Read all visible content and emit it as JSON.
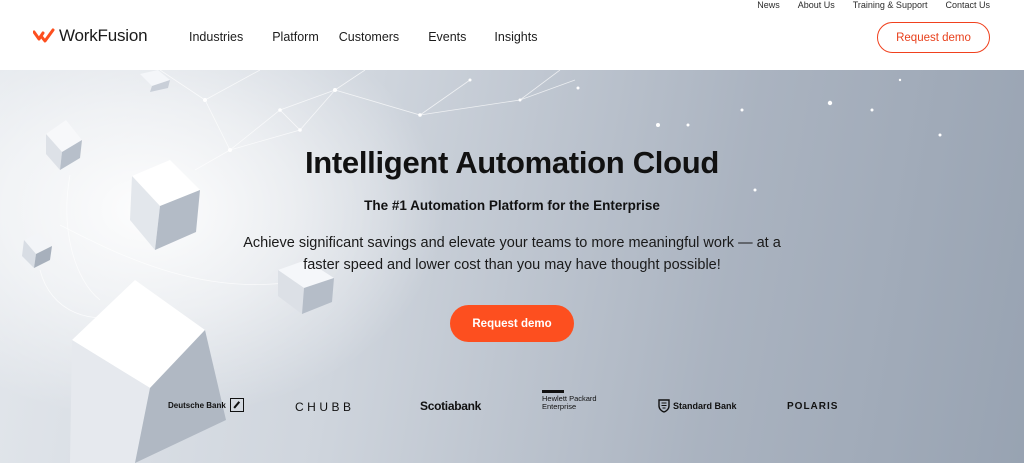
{
  "utility_nav": [
    "News",
    "About Us",
    "Training & Support",
    "Contact Us"
  ],
  "brand": {
    "name": "WorkFusion",
    "accent": "#fd4f1f"
  },
  "main_nav": [
    "Industries",
    "Platform",
    "Customers",
    "Events",
    "Insights"
  ],
  "header_cta": "Request demo",
  "hero": {
    "title": "Intelligent Automation Cloud",
    "subtitle": "The #1 Automation Platform for the Enterprise",
    "description": "Achieve significant savings and elevate your teams to more meaningful work — at a faster speed and lower cost than you may have thought possible!",
    "cta": "Request demo"
  },
  "clients": {
    "deutsche_bank": "Deutsche Bank",
    "chubb": "CHUBB",
    "scotiabank": "Scotiabank",
    "hpe_line1": "Hewlett Packard",
    "hpe_line2": "Enterprise",
    "standard_bank": "Standard Bank",
    "polaris": "POLARIS"
  }
}
